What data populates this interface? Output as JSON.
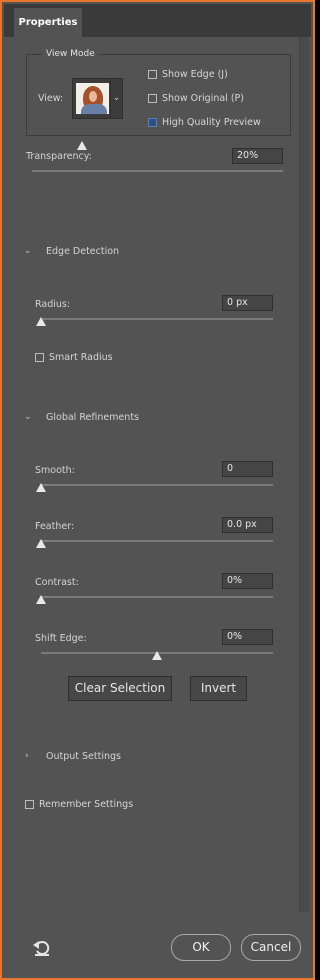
{
  "panel": {
    "tab_label": "Properties"
  },
  "view_mode": {
    "legend": "View Mode",
    "view_label": "View:",
    "show_edge": {
      "label": "Show Edge (J)",
      "checked": false
    },
    "show_original": {
      "label": "Show Original (P)",
      "checked": false
    },
    "high_quality_preview": {
      "label": "High Quality Preview",
      "checked": true
    }
  },
  "transparency": {
    "label": "Transparency:",
    "value": "20%",
    "level": 0.2
  },
  "edge_detection": {
    "title": "Edge Detection",
    "expanded": true,
    "radius": {
      "label": "Radius:",
      "value": "0 px",
      "level": 0
    },
    "smart_radius": {
      "label": "Smart Radius",
      "checked": false
    }
  },
  "global_refinements": {
    "title": "Global Refinements",
    "expanded": true,
    "smooth": {
      "label": "Smooth:",
      "value": "0",
      "level": 0
    },
    "feather": {
      "label": "Feather:",
      "value": "0.0 px",
      "level": 0
    },
    "contrast": {
      "label": "Contrast:",
      "value": "0%",
      "level": 0
    },
    "shift_edge": {
      "label": "Shift Edge:",
      "value": "0%",
      "level": 0.5
    }
  },
  "actions": {
    "clear_selection": "Clear Selection",
    "invert": "Invert"
  },
  "output_settings": {
    "title": "Output Settings",
    "expanded": false
  },
  "remember_settings": {
    "label": "Remember Settings",
    "checked": false
  },
  "footer": {
    "ok": "OK",
    "cancel": "Cancel",
    "reset_icon": "reset-icon"
  },
  "colors": {
    "panel_bg": "#535353",
    "frame_border": "#e8762b",
    "checkbox_checked": "#2c4f86"
  }
}
